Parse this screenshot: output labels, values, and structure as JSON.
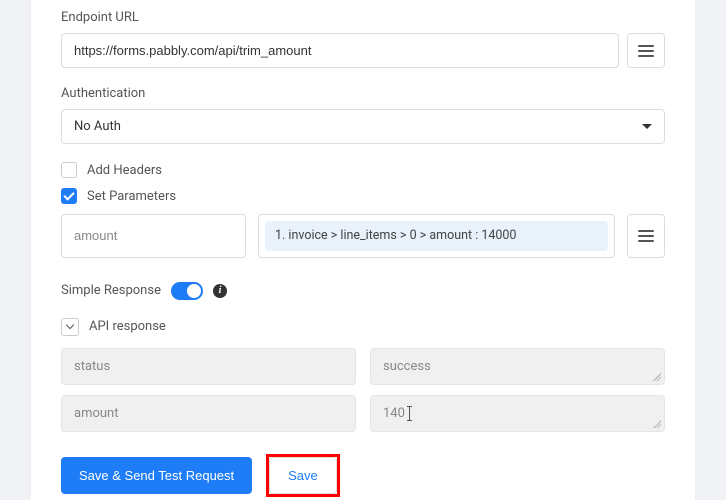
{
  "endpoint": {
    "label": "Endpoint URL",
    "value": "https://forms.pabbly.com/api/trim_amount"
  },
  "auth": {
    "label": "Authentication",
    "selected": "No Auth"
  },
  "headers": {
    "label": "Add Headers",
    "checked": false
  },
  "params": {
    "label": "Set Parameters",
    "checked": true,
    "key": "amount",
    "chip": "1. invoice > line_items > 0 > amount : 14000"
  },
  "simpleResponse": {
    "label": "Simple Response",
    "on": true
  },
  "apiResponse": {
    "label": "API response",
    "rows": [
      {
        "key": "status",
        "value": "success"
      },
      {
        "key": "amount",
        "value": "140"
      }
    ]
  },
  "buttons": {
    "primary": "Save & Send Test Request",
    "secondary": "Save"
  }
}
